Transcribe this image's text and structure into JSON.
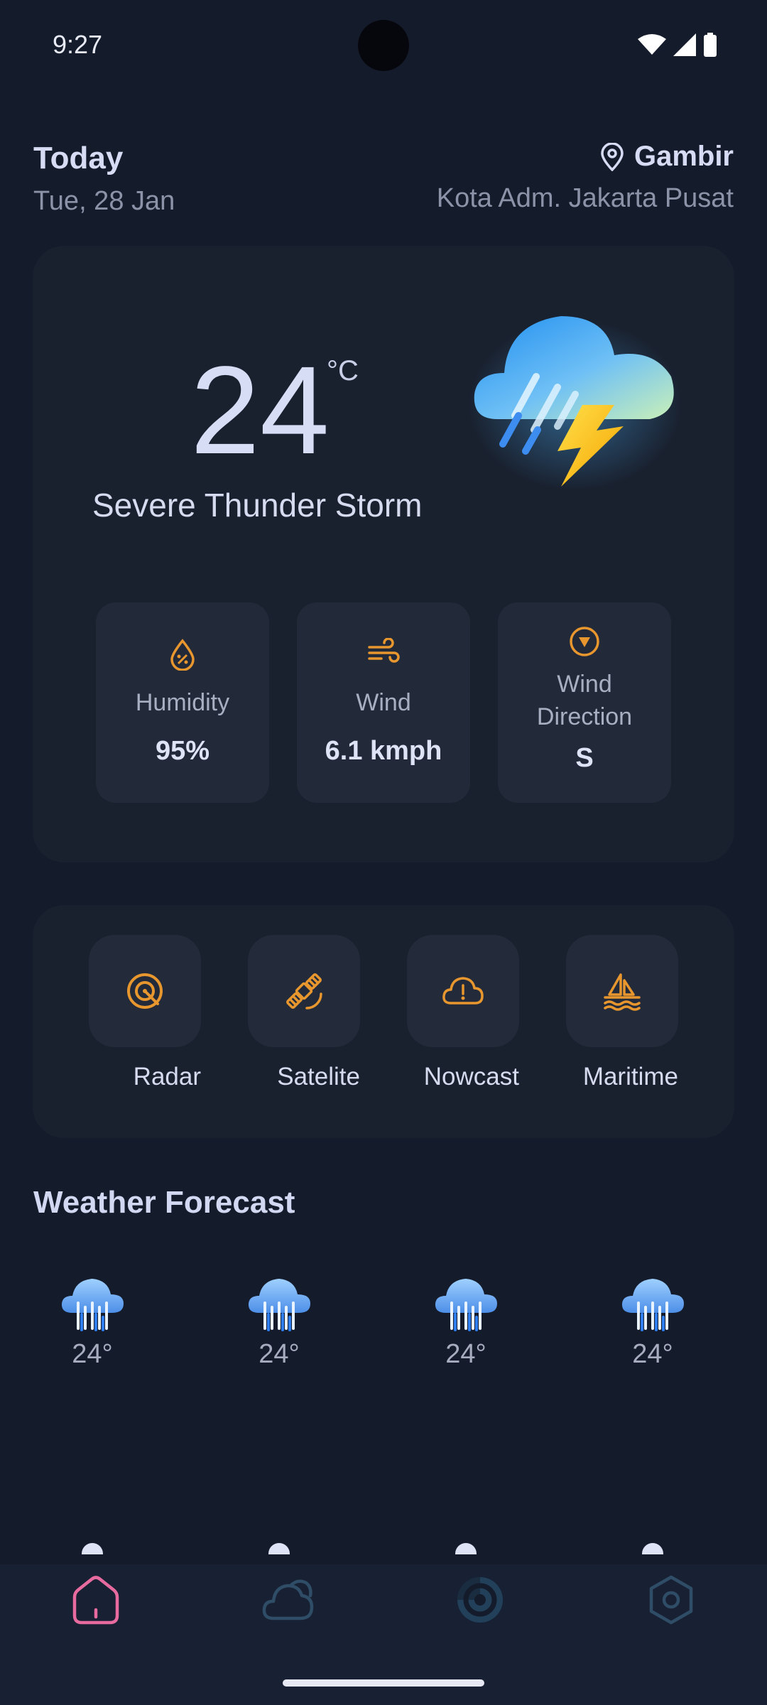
{
  "status_bar": {
    "time": "9:27"
  },
  "header": {
    "title": "Today",
    "date": "Tue, 28 Jan",
    "location": "Gambir",
    "region": "Kota Adm. Jakarta Pusat"
  },
  "current": {
    "temperature": "24",
    "unit": "°C",
    "condition": "Severe Thunder Storm",
    "condition_icon": "thunderstorm-icon"
  },
  "stats": [
    {
      "label": "Humidity",
      "value": "95%",
      "icon": "humidity-icon"
    },
    {
      "label": "Wind",
      "value": "6.1 kmph",
      "icon": "wind-icon"
    },
    {
      "label": "Wind\nDirection",
      "value": "S",
      "icon": "compass-icon"
    }
  ],
  "quick_actions": [
    {
      "label": "Radar",
      "icon": "radar-icon"
    },
    {
      "label": "Satelite",
      "icon": "satellite-icon"
    },
    {
      "label": "Nowcast",
      "icon": "cloud-alert-icon"
    },
    {
      "label": "Maritime",
      "icon": "sailboat-icon"
    }
  ],
  "forecast": {
    "title": "Weather Forecast",
    "items": [
      {
        "temp": "24°",
        "icon": "rain-icon"
      },
      {
        "temp": "24°",
        "icon": "rain-icon"
      },
      {
        "temp": "24°",
        "icon": "rain-icon"
      },
      {
        "temp": "24°",
        "icon": "rain-icon"
      }
    ]
  },
  "nav": [
    {
      "name": "home",
      "icon": "home-icon",
      "active": true
    },
    {
      "name": "weather",
      "icon": "cloud-icon",
      "active": false
    },
    {
      "name": "radar",
      "icon": "radar-icon",
      "active": false
    },
    {
      "name": "settings",
      "icon": "settings-icon",
      "active": false
    }
  ],
  "colors": {
    "background": "#141b2b",
    "card": "#19212f",
    "tile": "#232b3a",
    "accent": "#e8962e",
    "nav_active": "#e86ba0",
    "nav_inactive": "#2f4d66"
  }
}
